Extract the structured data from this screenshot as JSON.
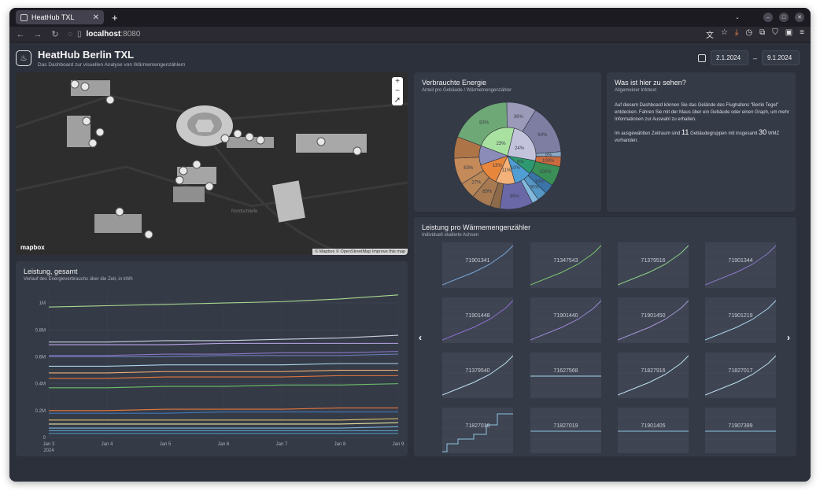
{
  "browser": {
    "tab_title": "HeatHub TXL",
    "url_host": "localhost",
    "url_port": ":8080"
  },
  "header": {
    "title": "HeatHub Berlin TXL",
    "subtitle": "Das Dashboard zur visuellen Analyse von Wärmemengenzählern",
    "date_from": "2.1.2024",
    "date_to": "9.1.2024",
    "date_sep": "–"
  },
  "map": {
    "zoom_in": "+",
    "zoom_out": "−",
    "compass": "➚",
    "attribution": "© Mapbox © OpenStreetMap  Improve this map",
    "brand": "mapbox",
    "street_label": "Nordschleife"
  },
  "pie": {
    "title": "Verbrauchte Energie",
    "subtitle": "Anteil pro Gebäude / Wärmemengenzähler"
  },
  "info": {
    "title": "Was ist hier zu sehen?",
    "subtitle": "Allgemeiner Infotext",
    "para1": "Auf diesem Dashboard können Sie das Gelände des Flughafens \"Berlin Tegel\" entdecken. Fahren Sie mit der Maus über ein Gebäude oder einen Graph, um mehr Informationen zur Auswahl zu erhalten.",
    "para2_a": "Im ausgewählten Zeitraum sind",
    "groups": "11",
    "para2_b": "Gebäudegruppen mit insgesamt",
    "wmz": "30",
    "para2_c": "WMZ vorhanden."
  },
  "line_chart": {
    "title": "Leistung, gesamt",
    "subtitle": "Verlauf des Energieverbrauchs über die Zeit, in kWh"
  },
  "meters": {
    "title": "Leistung pro Wärmemengenzähler",
    "subtitle": "Individuell skalierte Achsen",
    "prev": "‹",
    "next": "›",
    "items": [
      {
        "id": "71901341",
        "color": "#7aa6d6",
        "shape": "rise"
      },
      {
        "id": "71347543",
        "color": "#7cc46e",
        "shape": "rise"
      },
      {
        "id": "71379516",
        "color": "#8fd18a",
        "shape": "rise"
      },
      {
        "id": "71901344",
        "color": "#8a78c8",
        "shape": "rise"
      },
      {
        "id": "71901448",
        "color": "#8c6fd0",
        "shape": "rise"
      },
      {
        "id": "71901440",
        "color": "#9a86d4",
        "shape": "rise"
      },
      {
        "id": "71901450",
        "color": "#a796d8",
        "shape": "rise"
      },
      {
        "id": "71901219",
        "color": "#a9d4ea",
        "shape": "rise"
      },
      {
        "id": "71379540",
        "color": "#bfe0f0",
        "shape": "rise"
      },
      {
        "id": "71627568",
        "color": "#a9d4ea",
        "shape": "flat"
      },
      {
        "id": "71827916",
        "color": "#bfe0f0",
        "shape": "rise"
      },
      {
        "id": "71827017",
        "color": "#bfe0f0",
        "shape": "rise"
      },
      {
        "id": "71827018",
        "color": "#8fc3e0",
        "shape": "step"
      },
      {
        "id": "71827019",
        "color": "#8fc3e0",
        "shape": "flat"
      },
      {
        "id": "71901405",
        "color": "#8fc3e0",
        "shape": "flat"
      },
      {
        "id": "71907399",
        "color": "#8fc3e0",
        "shape": "flat"
      }
    ]
  },
  "chart_data": [
    {
      "type": "line",
      "title": "Leistung, gesamt",
      "subtitle": "Verlauf des Energieverbrauchs über die Zeit, in kWh",
      "x": [
        "Jan 3 2024",
        "Jan 4",
        "Jan 5",
        "Jan 6",
        "Jan 7",
        "Jan 8",
        "Jan 9"
      ],
      "x_tick_labels": [
        "Jan 3",
        "Jan 4",
        "Jan 5",
        "Jan 6",
        "Jan 7",
        "Jan 8",
        "Jan 9"
      ],
      "x_year_label": "2024",
      "y_tick_labels": [
        "0",
        "0.2M",
        "0.4M",
        "0.6M",
        "0.8M",
        "1M"
      ],
      "ylim": [
        0,
        1.1
      ],
      "grid": true,
      "series": [
        {
          "color": "#a7d88f",
          "values": [
            0.97,
            0.98,
            0.99,
            1.0,
            1.01,
            1.03,
            1.06
          ]
        },
        {
          "color": "#c9d1e3",
          "values": [
            0.71,
            0.71,
            0.72,
            0.72,
            0.73,
            0.74,
            0.76
          ]
        },
        {
          "color": "#b9a6e6",
          "values": [
            0.69,
            0.69,
            0.69,
            0.7,
            0.7,
            0.7,
            0.7
          ]
        },
        {
          "color": "#8a78c8",
          "values": [
            0.61,
            0.61,
            0.62,
            0.62,
            0.63,
            0.63,
            0.64
          ]
        },
        {
          "color": "#6b7db8",
          "values": [
            0.6,
            0.6,
            0.6,
            0.61,
            0.61,
            0.61,
            0.62
          ]
        },
        {
          "color": "#a9d4ea",
          "values": [
            0.53,
            0.53,
            0.54,
            0.54,
            0.54,
            0.55,
            0.55
          ]
        },
        {
          "color": "#f0b074",
          "values": [
            0.48,
            0.48,
            0.49,
            0.49,
            0.49,
            0.5,
            0.5
          ]
        },
        {
          "color": "#e2773c",
          "values": [
            0.44,
            0.44,
            0.45,
            0.45,
            0.45,
            0.46,
            0.46
          ]
        },
        {
          "color": "#6cc06a",
          "values": [
            0.37,
            0.37,
            0.38,
            0.38,
            0.39,
            0.39,
            0.4
          ]
        },
        {
          "color": "#e8793a",
          "values": [
            0.2,
            0.2,
            0.21,
            0.21,
            0.21,
            0.22,
            0.22
          ]
        },
        {
          "color": "#3f78b8",
          "values": [
            0.18,
            0.18,
            0.18,
            0.19,
            0.19,
            0.19,
            0.19
          ]
        },
        {
          "color": "#d9c070",
          "values": [
            0.13,
            0.13,
            0.13,
            0.13,
            0.13,
            0.13,
            0.14
          ]
        },
        {
          "color": "#e6e6a0",
          "values": [
            0.1,
            0.1,
            0.1,
            0.1,
            0.1,
            0.1,
            0.11
          ]
        },
        {
          "color": "#7fb6d8",
          "values": [
            0.07,
            0.07,
            0.07,
            0.07,
            0.07,
            0.07,
            0.08
          ]
        },
        {
          "color": "#5aa0c8",
          "values": [
            0.05,
            0.05,
            0.05,
            0.05,
            0.05,
            0.05,
            0.05
          ]
        },
        {
          "color": "#4f9ec8",
          "values": [
            0.03,
            0.03,
            0.03,
            0.03,
            0.03,
            0.03,
            0.03
          ]
        }
      ]
    },
    {
      "type": "pie",
      "title": "Verbrauchte Energie",
      "subtitle": "Anteil pro Gebäude / Wärmemengenzähler",
      "inner": [
        {
          "label": "23%",
          "value": 23,
          "color": "#a8e1a0"
        },
        {
          "label": "24%",
          "value": 24,
          "color": "#c3c3dc"
        },
        {
          "label": "8%",
          "value": 8,
          "color": "#2e9970"
        },
        {
          "label": "10%",
          "value": 10,
          "color": "#4f9fd4"
        },
        {
          "label": "11%",
          "value": 11,
          "color": "#f3b27a"
        },
        {
          "label": "13%",
          "value": 13,
          "color": "#e8863c"
        },
        {
          "label": "",
          "value": 11,
          "color": "#8b8cb8"
        }
      ],
      "outer": [
        {
          "label": "83%",
          "value": 19,
          "color": "#6fa877"
        },
        {
          "label": "36%",
          "value": 9,
          "color": "#9b9ab8"
        },
        {
          "label": "64%",
          "value": 15,
          "color": "#7e7ea3"
        },
        {
          "label": "5%",
          "value": 1.5,
          "color": "#8aa8c4"
        },
        {
          "label": "100%",
          "value": 3,
          "color": "#c96a3e"
        },
        {
          "label": "100%",
          "value": 6,
          "color": "#3a8f56"
        },
        {
          "label": "34%",
          "value": 3,
          "color": "#3a74a8"
        },
        {
          "label": "30%",
          "value": 3,
          "color": "#5596c4"
        },
        {
          "label": "",
          "value": 2,
          "color": "#82b8dc"
        },
        {
          "label": "86%",
          "value": 10,
          "color": "#6b68a8"
        },
        {
          "label": "",
          "value": 3,
          "color": "#8c6a4a"
        },
        {
          "label": "69%",
          "value": 6,
          "color": "#a77a52"
        },
        {
          "label": "27%",
          "value": 5,
          "color": "#b98658"
        },
        {
          "label": "63%",
          "value": 8,
          "color": "#c48a5a"
        },
        {
          "label": "",
          "value": 6.5,
          "color": "#ad7547"
        }
      ]
    }
  ]
}
